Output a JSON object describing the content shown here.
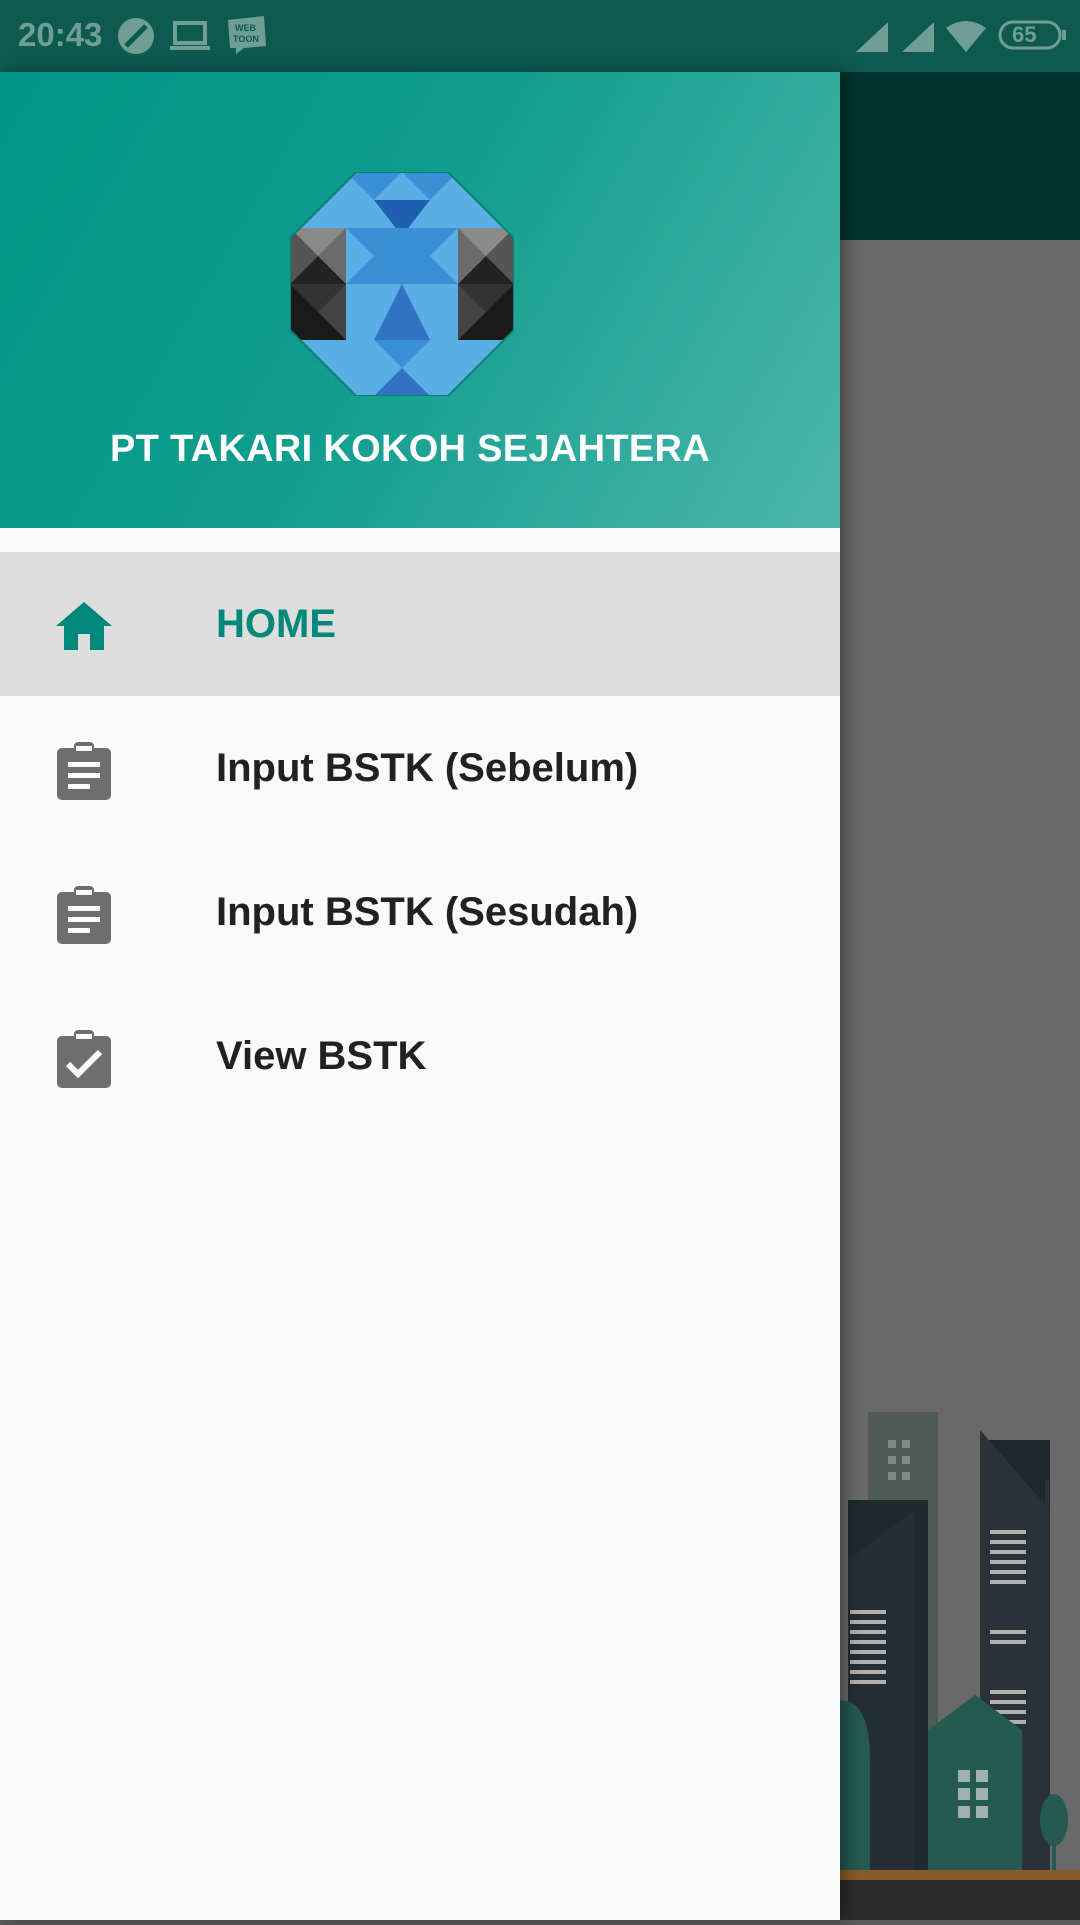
{
  "status_bar": {
    "time": "20:43",
    "battery": "65",
    "left_icons": [
      "data-saver-icon",
      "laptop-icon",
      "webtoon-icon"
    ],
    "webtoon_text": "WEB TOON",
    "right_icons": [
      "signal-icon",
      "signal-icon",
      "wifi-icon",
      "battery-icon"
    ]
  },
  "drawer": {
    "company_name": "PT TAKARI KOKOH SEJAHTERA",
    "items": [
      {
        "label": "HOME",
        "icon": "home-icon",
        "active": true
      },
      {
        "label": "Input BSTK (Sebelum)",
        "icon": "clipboard-icon",
        "active": false
      },
      {
        "label": "Input BSTK (Sesudah)",
        "icon": "clipboard-icon",
        "active": false
      },
      {
        "label": "View BSTK",
        "icon": "clipboard-check-icon",
        "active": false
      }
    ]
  },
  "colors": {
    "accent": "#00897b",
    "header_start": "#009688",
    "header_end": "#4db6ac",
    "status_bar": "#0e5a4f",
    "active_item_bg": "#dddddd"
  }
}
